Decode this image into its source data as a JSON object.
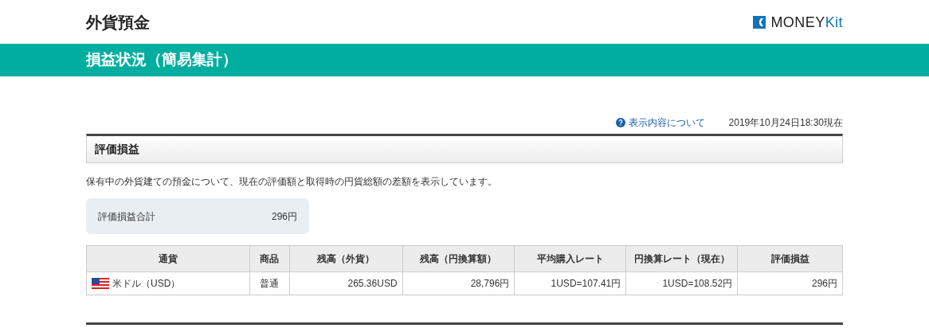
{
  "header": {
    "title": "外貨預金",
    "logo": {
      "main": "MONEY",
      "accent": "Kit"
    }
  },
  "banner": {
    "title": "損益状況（簡易集計）"
  },
  "info": {
    "link": "表示内容について",
    "timestamp": "2019年10月24日18:30現在"
  },
  "section": {
    "title": "評価損益",
    "description": "保有中の外貨建ての預金について、現在の評価額と取得時の円貨総額の差額を表示しています。",
    "summary": {
      "label": "評価損益合計",
      "value": "296円"
    },
    "table": {
      "columns": [
        "通貨",
        "商品",
        "残高（外貨）",
        "残高（円換算額）",
        "平均購入レート",
        "円換算レート（現在）",
        "評価損益"
      ],
      "rows": [
        {
          "kind": "usd",
          "cells": [
            "米ドル（USD）",
            "普通",
            "265.36USD",
            "28,796円",
            "1USD=107.41円",
            "1USD=108.52円",
            "296円"
          ]
        }
      ]
    }
  }
}
